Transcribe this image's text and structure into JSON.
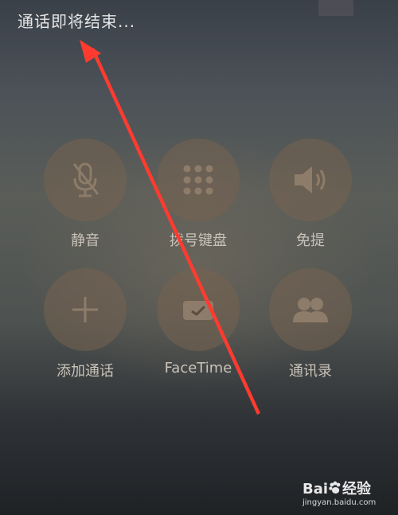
{
  "call": {
    "status_text": "通话即将结束..."
  },
  "controls": {
    "mute_label": "静音",
    "keypad_label": "拨号键盘",
    "speaker_label": "免提",
    "add_call_label": "添加通话",
    "facetime_label": "FaceTime",
    "contacts_label": "通讯录"
  },
  "watermark": {
    "brand": "Bai",
    "brand_cn": "经验",
    "url": "jingyan.baidu.com"
  },
  "icons": {
    "mute": "microphone-slash-icon",
    "keypad": "keypad-grid-icon",
    "speaker": "speaker-icon",
    "add_call": "plus-icon",
    "facetime": "video-camera-icon",
    "contacts": "people-icon",
    "watermark_paw": "paw-icon"
  },
  "colors": {
    "annotation_arrow": "#ff3b30",
    "status_text": "#e6e6e6",
    "control_fill": "#766250",
    "label_text": "#c9c2b8"
  }
}
